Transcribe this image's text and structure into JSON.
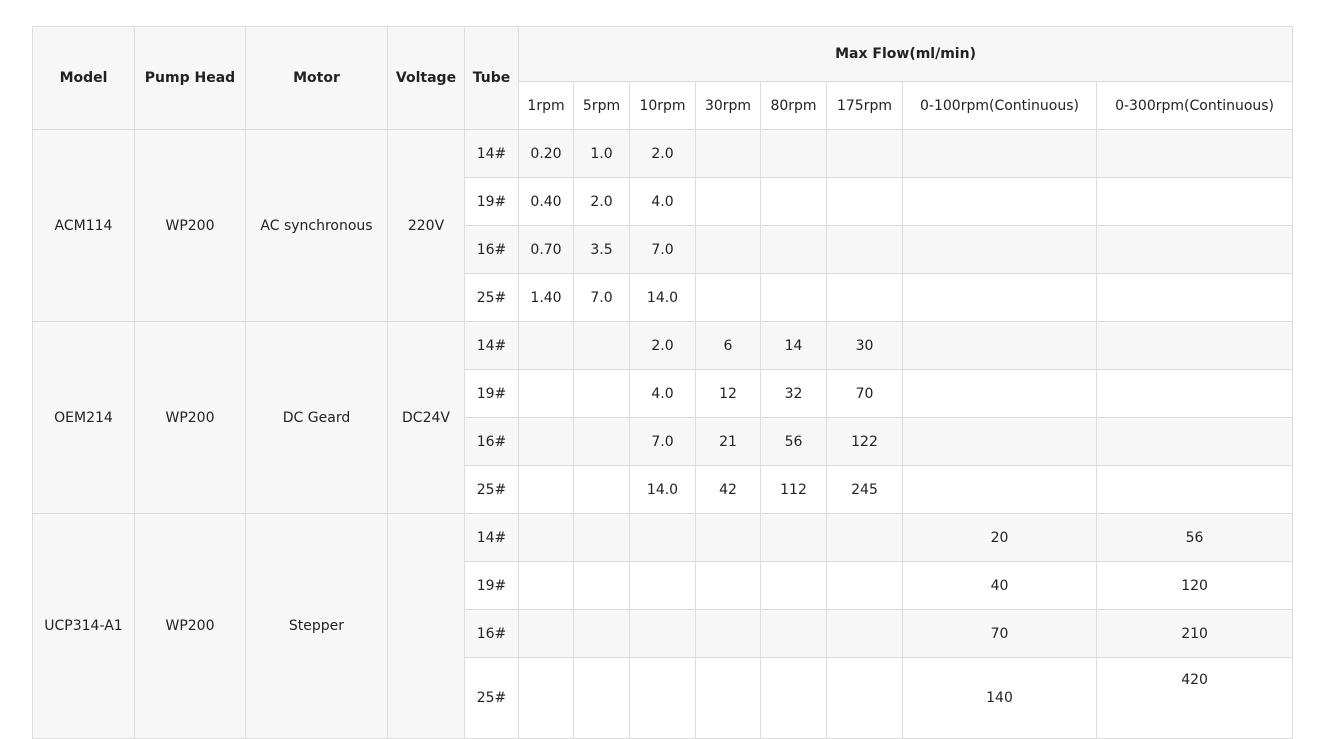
{
  "table": {
    "headers": {
      "model": "Model",
      "pump_head": "Pump Head",
      "motor": "Motor",
      "voltage": "Voltage",
      "tube": "Tube",
      "max_flow": "Max Flow(ml/min)"
    },
    "speeds": [
      "1rpm",
      "5rpm",
      "10rpm",
      "30rpm",
      "80rpm",
      "175rpm",
      "0-100rpm(Continuous)",
      "0-300rpm(Continuous)"
    ],
    "groups": [
      {
        "model": "ACM114",
        "pump_head": "WP200",
        "motor": "AC synchronous",
        "voltage": "220V",
        "rows": [
          {
            "tube": "14#",
            "values": [
              "0.20",
              "1.0",
              "2.0",
              "",
              "",
              "",
              "",
              ""
            ]
          },
          {
            "tube": "19#",
            "values": [
              "0.40",
              "2.0",
              "4.0",
              "",
              "",
              "",
              "",
              ""
            ]
          },
          {
            "tube": "16#",
            "values": [
              "0.70",
              "3.5",
              "7.0",
              "",
              "",
              "",
              "",
              ""
            ]
          },
          {
            "tube": "25#",
            "values": [
              "1.40",
              "7.0",
              "14.0",
              "",
              "",
              "",
              "",
              ""
            ]
          }
        ]
      },
      {
        "model": "OEM214",
        "pump_head": "WP200",
        "motor": "DC Geard",
        "voltage": "DC24V",
        "rows": [
          {
            "tube": "14#",
            "values": [
              "",
              "",
              "2.0",
              "6",
              "14",
              "30",
              "",
              ""
            ]
          },
          {
            "tube": "19#",
            "values": [
              "",
              "",
              "4.0",
              "12",
              "32",
              "70",
              "",
              ""
            ]
          },
          {
            "tube": "16#",
            "values": [
              "",
              "",
              "7.0",
              "21",
              "56",
              "122",
              "",
              ""
            ]
          },
          {
            "tube": "25#",
            "values": [
              "",
              "",
              "14.0",
              "42",
              "112",
              "245",
              "",
              ""
            ]
          }
        ]
      },
      {
        "model": "UCP314-A1",
        "pump_head": "WP200",
        "motor": "Stepper",
        "voltage": "",
        "rows": [
          {
            "tube": "14#",
            "values": [
              "",
              "",
              "",
              "",
              "",
              "",
              "20",
              "56"
            ]
          },
          {
            "tube": "19#",
            "values": [
              "",
              "",
              "",
              "",
              "",
              "",
              "40",
              "120"
            ]
          },
          {
            "tube": "16#",
            "values": [
              "",
              "",
              "",
              "",
              "",
              "",
              "70",
              "210"
            ]
          },
          {
            "tube": "25#",
            "values": [
              "",
              "",
              "",
              "",
              "",
              "",
              "140",
              "420"
            ]
          }
        ]
      }
    ]
  }
}
